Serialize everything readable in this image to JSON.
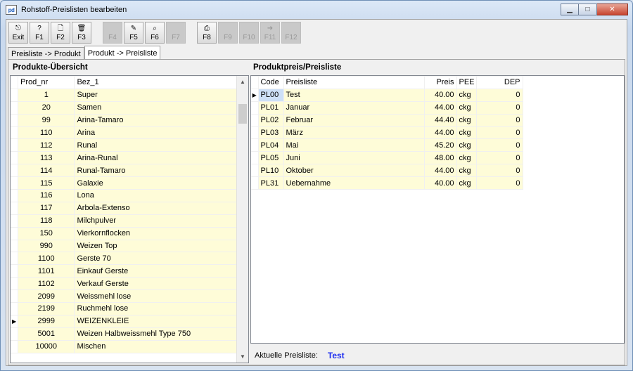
{
  "window": {
    "title": "Rohstoff-Preislisten bearbeiten",
    "icon_text": "pd"
  },
  "toolbar": [
    {
      "label": "Exit",
      "icon": "exit-icon",
      "glyph": "⎋",
      "enabled": true
    },
    {
      "label": "F1",
      "icon": "help-icon",
      "glyph": "?",
      "enabled": true
    },
    {
      "label": "F2",
      "icon": "new-document-icon",
      "glyph": "🗋",
      "enabled": true
    },
    {
      "label": "F3",
      "icon": "trash-icon",
      "glyph": "🗑",
      "enabled": true
    },
    {
      "label": "F4",
      "icon": "blank-icon",
      "glyph": "",
      "enabled": false
    },
    {
      "label": "F5",
      "icon": "edit-list-icon",
      "glyph": "✎",
      "enabled": true
    },
    {
      "label": "F6",
      "icon": "search-icon",
      "glyph": "⌕",
      "enabled": true
    },
    {
      "label": "F7",
      "icon": "blank-icon",
      "glyph": "",
      "enabled": false
    },
    {
      "label": "F8",
      "icon": "print-icon",
      "glyph": "⎙",
      "enabled": true
    },
    {
      "label": "F9",
      "icon": "blank-icon",
      "glyph": "",
      "enabled": false
    },
    {
      "label": "F10",
      "icon": "blank-icon",
      "glyph": "",
      "enabled": false
    },
    {
      "label": "F11",
      "icon": "export-icon",
      "glyph": "➜",
      "enabled": false
    },
    {
      "label": "F12",
      "icon": "blank-icon",
      "glyph": "",
      "enabled": false
    }
  ],
  "tabs": [
    {
      "label": "Preisliste -> Produkt",
      "active": false
    },
    {
      "label": "Produkt -> Preisliste",
      "active": true
    }
  ],
  "left": {
    "title": "Produkte-Übersicht",
    "columns": [
      "Prod_nr",
      "Bez_1"
    ],
    "rows": [
      [
        "1",
        "Super"
      ],
      [
        "20",
        "Samen"
      ],
      [
        "99",
        "Arina-Tamaro"
      ],
      [
        "110",
        "Arina"
      ],
      [
        "112",
        "Runal"
      ],
      [
        "113",
        "Arina-Runal"
      ],
      [
        "114",
        "Runal-Tamaro"
      ],
      [
        "115",
        "Galaxie"
      ],
      [
        "116",
        "Lona"
      ],
      [
        "117",
        "Arbola-Extenso"
      ],
      [
        "118",
        "Milchpulver"
      ],
      [
        "150",
        "Vierkornflocken"
      ],
      [
        "990",
        "Weizen Top"
      ],
      [
        "1100",
        "Gerste 70"
      ],
      [
        "1101",
        "Einkauf Gerste"
      ],
      [
        "1102",
        "Verkauf Gerste"
      ],
      [
        "2099",
        "Weissmehl lose"
      ],
      [
        "2199",
        "Ruchmehl lose"
      ],
      [
        "2999",
        "WEIZENKLEIE"
      ],
      [
        "5001",
        "Weizen Halbweissmehl Type 750"
      ],
      [
        "10000",
        "Mischen"
      ]
    ],
    "current_row": 18
  },
  "right": {
    "title": "Produktpreis/Preisliste",
    "columns": [
      "Code",
      "Preisliste",
      "Preis",
      "PEE",
      "DEP"
    ],
    "rows": [
      [
        "PL00",
        "Test",
        "40.00",
        "ckg",
        "0"
      ],
      [
        "PL01",
        "Januar",
        "44.00",
        "ckg",
        "0"
      ],
      [
        "PL02",
        "Februar",
        "44.40",
        "ckg",
        "0"
      ],
      [
        "PL03",
        "März",
        "44.00",
        "ckg",
        "0"
      ],
      [
        "PL04",
        "Mai",
        "45.20",
        "ckg",
        "0"
      ],
      [
        "PL05",
        "Juni",
        "48.00",
        "ckg",
        "0"
      ],
      [
        "PL10",
        "Oktober",
        "44.00",
        "ckg",
        "0"
      ],
      [
        "PL31",
        "Uebernahme",
        "40.00",
        "ckg",
        "0"
      ]
    ],
    "current_row": 0,
    "status_label": "Aktuelle Preisliste:",
    "status_value": "Test"
  }
}
